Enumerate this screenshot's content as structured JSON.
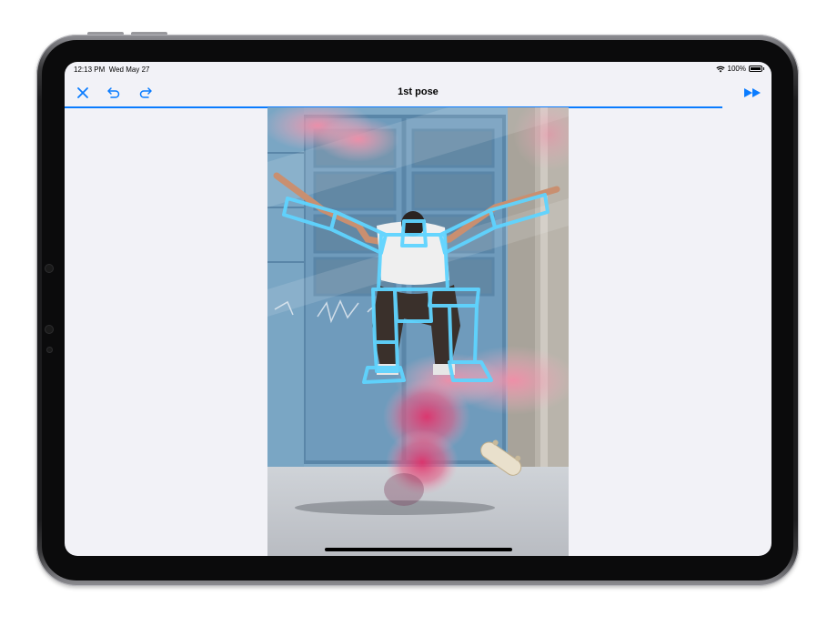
{
  "status_bar": {
    "time": "12:13 PM",
    "date": "Wed May 27",
    "battery_level": "100%",
    "battery_fraction": 1.0,
    "wifi_icon": "wifi-icon",
    "battery_icon": "battery-icon"
  },
  "toolbar": {
    "title": "1st pose",
    "close_icon": "close-icon",
    "undo_icon": "undo-icon",
    "redo_icon": "redo-icon",
    "next_icon": "fast-forward-icon"
  },
  "progress": {
    "fraction": 0.93
  },
  "colors": {
    "accent": "#0a7cff",
    "background": "#f2f2f7",
    "pose_stroke": "#5fd4ff"
  }
}
